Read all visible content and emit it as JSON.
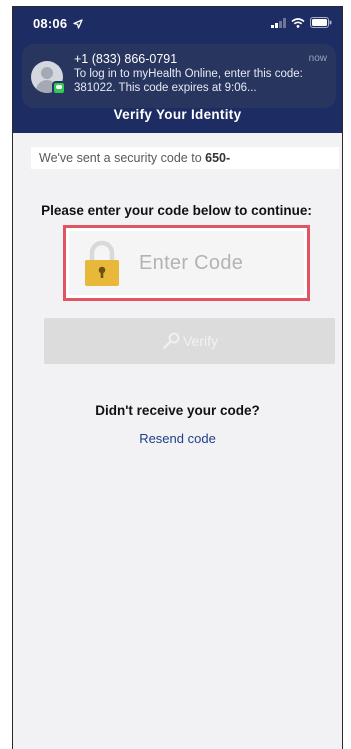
{
  "status_bar": {
    "time": "08:06",
    "location_icon": "location-arrow-icon",
    "signal_icon": "signal-icon",
    "wifi_icon": "wifi-icon",
    "battery_icon": "battery-icon"
  },
  "notification": {
    "sender": "+1 (833) 866-0791",
    "time": "now",
    "body": "To log in to myHealth Online, enter this code: 381022.  This code expires at  9:06...",
    "avatar_icon": "contact-avatar-icon",
    "badge_icon": "messages-app-icon"
  },
  "header": {
    "title": "Verify Your Identity"
  },
  "sent_banner": {
    "text": "We've sent a security code to ",
    "number": "650-"
  },
  "instruction": "Please enter your code below to continue:",
  "code_input": {
    "placeholder": "Enter Code",
    "value": "",
    "icon": "padlock-icon",
    "highlight_color": "#e05561"
  },
  "verify_button": {
    "label": "Verify",
    "icon": "wrench-icon",
    "enabled": false
  },
  "no_code_label": "Didn't receive your code?",
  "resend_link": "Resend code",
  "colors": {
    "header_bg": "#1d2d63",
    "link": "#1d3f8a",
    "lock": "#e7b83a"
  }
}
